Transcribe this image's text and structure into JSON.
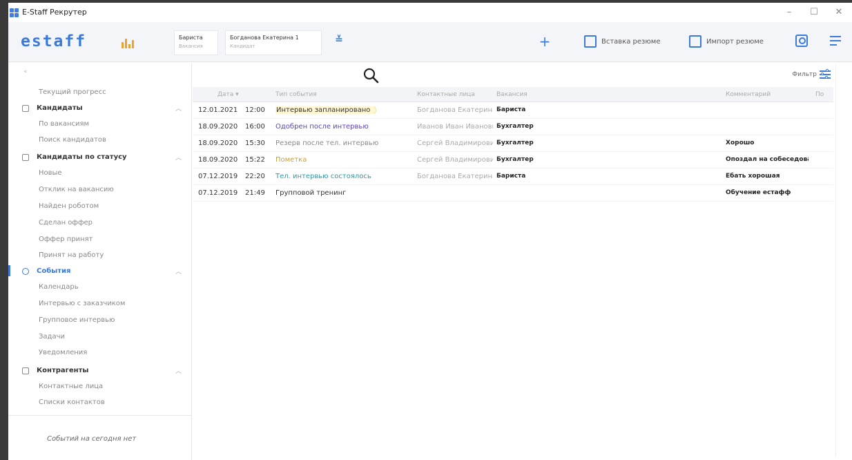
{
  "window": {
    "title": "E-Staff Рекрутер"
  },
  "header": {
    "logo": "estaff",
    "tabs": [
      {
        "name": "Бариста",
        "sub": "Вакансия"
      },
      {
        "name": "Богданова Екатерина 1",
        "sub": "Кандидат"
      }
    ],
    "insert_resume": "Вставка резюме",
    "import_resume": "Импорт резюме"
  },
  "sidebar": {
    "items": [
      {
        "label": "Текущий прогресс"
      },
      {
        "label": "Кандидаты"
      },
      {
        "label": "По вакансиям"
      },
      {
        "label": "Поиск кандидатов"
      },
      {
        "label": "Кандидаты по статусу"
      },
      {
        "label": "Новые"
      },
      {
        "label": "Отклик на вакансию"
      },
      {
        "label": "Найден роботом"
      },
      {
        "label": "Сделан оффер"
      },
      {
        "label": "Оффер принят"
      },
      {
        "label": "Принят на работу"
      },
      {
        "label": "События"
      },
      {
        "label": "Календарь"
      },
      {
        "label": "Интервью с заказчиком"
      },
      {
        "label": "Групповое интервью"
      },
      {
        "label": "Задачи"
      },
      {
        "label": "Уведомления"
      },
      {
        "label": "Контрагенты"
      },
      {
        "label": "Контактные лица"
      },
      {
        "label": "Списки контактов"
      }
    ],
    "empty_note": "Событий на сегодня нет"
  },
  "main": {
    "filter_label": "Фильтр",
    "columns": [
      "Дата ▾",
      "Тип события",
      "Контактные лица",
      "Вакансия",
      "Комментарий",
      "По"
    ],
    "rows": [
      {
        "date": "12.01.2021",
        "time": "12:00",
        "type": "Интервью запланировано",
        "type_color": "#333333",
        "contact": "Богданова Екатерина",
        "vacancy": "Бариста",
        "comment": ""
      },
      {
        "date": "18.09.2020",
        "time": "16:00",
        "type": "Одобрен после интервью",
        "type_color": "#5a3fc0",
        "contact": "Иванов Иван Иванович",
        "vacancy": "Бухгалтер",
        "comment": ""
      },
      {
        "date": "18.09.2020",
        "time": "15:30",
        "type": "Резерв после тел. интервью",
        "type_color": "#888888",
        "contact": "Сергей Владимирович",
        "vacancy": "Бухгалтер",
        "comment": "Хорошо"
      },
      {
        "date": "18.09.2020",
        "time": "15:22",
        "type": "Пометка",
        "type_color": "#c9a227",
        "contact": "Сергей Владимирович",
        "vacancy": "Бухгалтер",
        "comment": "Опоздал на собеседование"
      },
      {
        "date": "07.12.2019",
        "time": "22:20",
        "type": "Тел. интервью состоялось",
        "type_color": "#2a9aa8",
        "contact": "Богданова Екатерина",
        "vacancy": "Бариста",
        "comment": "Ебать хорошая"
      },
      {
        "date": "07.12.2019",
        "time": "21:49",
        "type": "Групповой тренинг",
        "type_color": "#333333",
        "contact": "",
        "vacancy": "",
        "comment": "Обучение естафф"
      }
    ]
  }
}
